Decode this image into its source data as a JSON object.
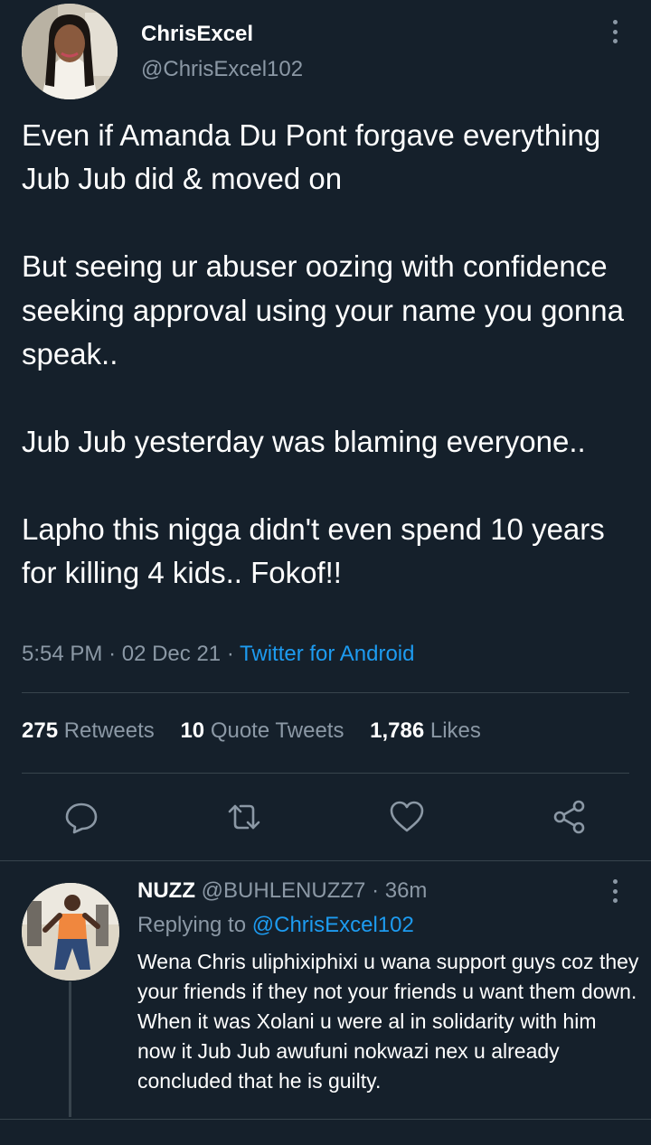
{
  "tweet": {
    "author_name": "ChrisExcel",
    "author_handle": "@ChrisExcel102",
    "text": "Even if Amanda Du Pont forgave everything Jub Jub did & moved on\n\nBut seeing ur abuser oozing with confidence seeking approval using your name you gonna speak..\n\nJub Jub yesterday was blaming everyone..\n\nLapho this nigga didn't even spend 10 years for killing 4 kids.. Fokof!!",
    "time": "5:54 PM",
    "date": "02 Dec 21",
    "separator": "·",
    "source": "Twitter for Android"
  },
  "stats": {
    "retweets_count": "275",
    "retweets_label": "Retweets",
    "quotes_count": "10",
    "quotes_label": "Quote Tweets",
    "likes_count": "1,786",
    "likes_label": "Likes"
  },
  "actions": {
    "reply_icon": "reply-icon",
    "retweet_icon": "retweet-icon",
    "like_icon": "heart-icon",
    "share_icon": "share-icon"
  },
  "reply": {
    "author_name": "NUZZ",
    "author_handle": "@BUHLENUZZ7",
    "time_ago": "36m",
    "separator": "·",
    "replying_prefix": "Replying to",
    "replying_to": "@ChrisExcel102",
    "text": "Wena Chris uliphixiphixi u wana support guys coz they your friends if they not your friends u want them down. When it was Xolani u were al in solidarity with him now it Jub Jub awufuni nokwazi nex u already concluded that he is guilty."
  },
  "colors": {
    "background": "#15202b",
    "text": "#ffffff",
    "secondary": "#8b98a5",
    "accent": "#1d9bf0",
    "divider": "#38444d"
  }
}
